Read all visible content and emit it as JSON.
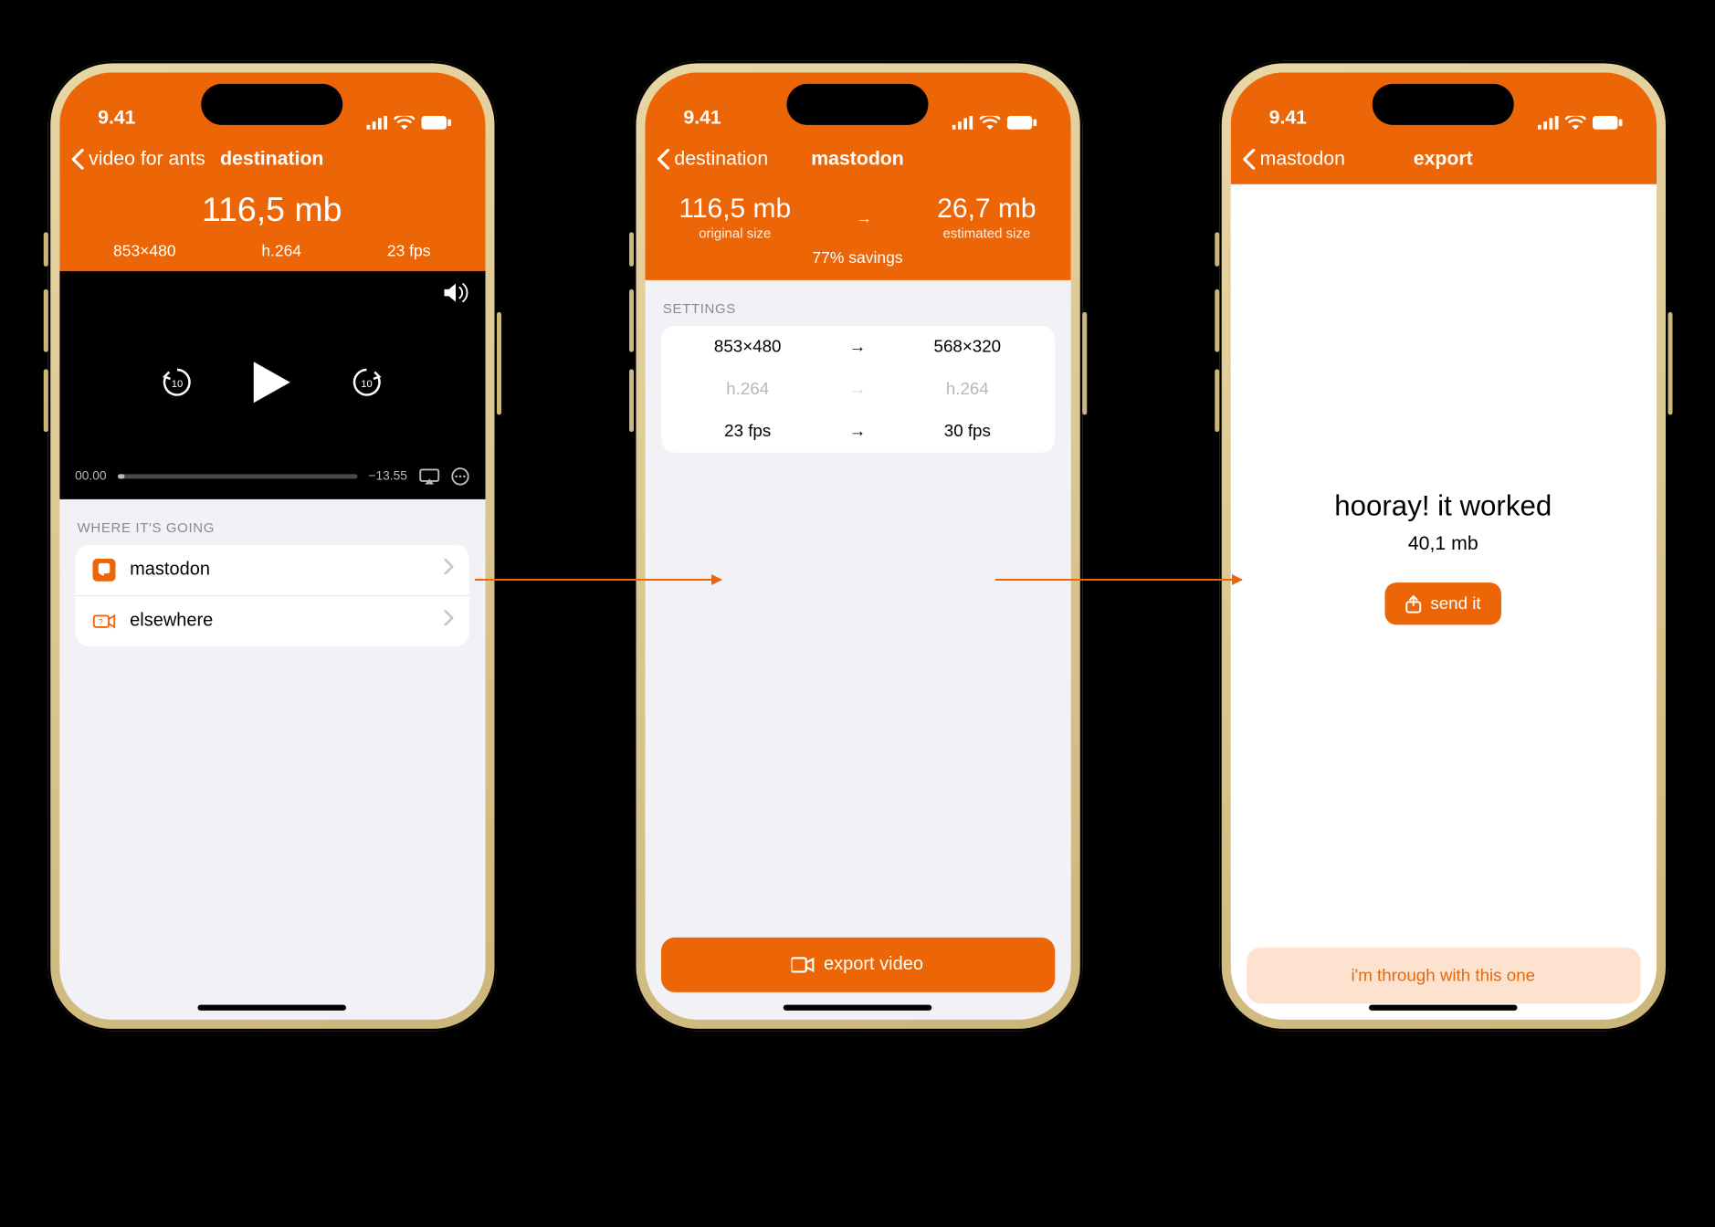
{
  "status": {
    "time": "9.41"
  },
  "screen1": {
    "back": "video for ants",
    "title": "destination",
    "size": "116,5 mb",
    "res": "853×480",
    "codec": "h.264",
    "fps": "23 fps",
    "seek_start": "00.00",
    "seek_end": "−13.55",
    "section_header": "WHERE IT'S GOING",
    "destinations": [
      {
        "label": "mastodon"
      },
      {
        "label": "elsewhere"
      }
    ]
  },
  "screen2": {
    "back": "destination",
    "title": "mastodon",
    "orig_size": "116,5 mb",
    "orig_label": "original size",
    "est_size": "26,7 mb",
    "est_label": "estimated size",
    "savings": "77% savings",
    "settings_header": "SETTINGS",
    "rows": [
      {
        "from": "853×480",
        "to": "568×320",
        "dim": false
      },
      {
        "from": "h.264",
        "to": "h.264",
        "dim": true
      },
      {
        "from": "23 fps",
        "to": "30 fps",
        "dim": false
      }
    ],
    "export_label": "export video"
  },
  "screen3": {
    "back": "mastodon",
    "title": "export",
    "headline": "hooray! it worked",
    "size": "40,1 mb",
    "send_label": "send it",
    "done_label": "i'm through with this one"
  }
}
